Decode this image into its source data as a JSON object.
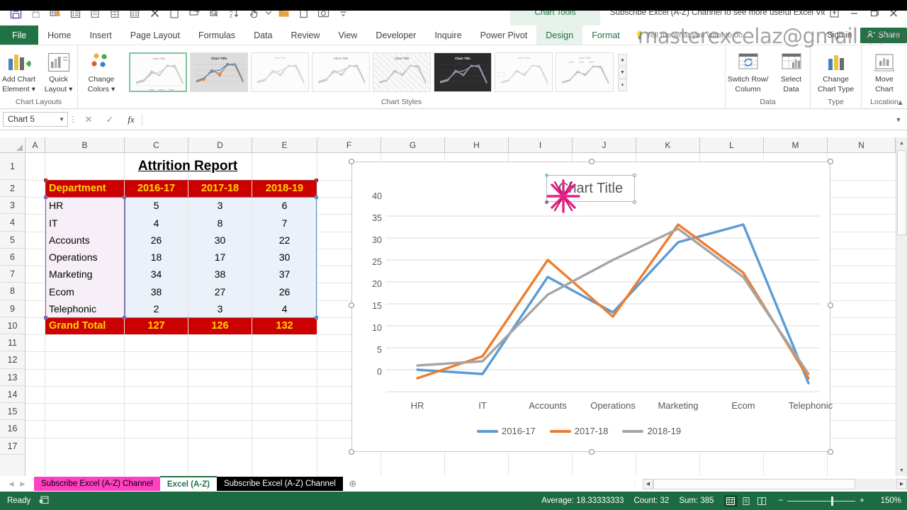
{
  "window": {
    "chart_tools_label": "Chart Tools",
    "document_title": "Subscribe Excel (A-Z) Channel to see more useful Excel Vide...",
    "watermark": "masterexcelaz@gmail.com",
    "restore_icon": "restore-up-icon",
    "minimize_icon": "minimize-icon",
    "maximize_icon": "maximize-icon",
    "close_icon": "close-icon"
  },
  "quick_access": [
    {
      "name": "save-icon",
      "glyph": "💾"
    },
    {
      "name": "lock-icon",
      "glyph": "🔒"
    },
    {
      "name": "protect-sheet-icon",
      "glyph": "▦"
    },
    {
      "name": "format-cells-icon",
      "glyph": "☷"
    },
    {
      "name": "table-icon",
      "glyph": "☰"
    },
    {
      "name": "grid-icon",
      "glyph": "▤"
    },
    {
      "name": "sheet-icon",
      "glyph": "▥"
    },
    {
      "name": "delete-icon",
      "glyph": "✕"
    },
    {
      "name": "paste-icon",
      "glyph": "📋"
    },
    {
      "name": "print-preview-icon",
      "glyph": "🖨"
    },
    {
      "name": "zoom-icon",
      "glyph": "🔍"
    },
    {
      "name": "sort-az-icon",
      "glyph": "↓"
    },
    {
      "name": "select-icon",
      "glyph": "☝"
    },
    {
      "name": "open-folder-icon",
      "glyph": "📁"
    },
    {
      "name": "new-file-icon",
      "glyph": "📄"
    },
    {
      "name": "camera-icon",
      "glyph": "📷"
    },
    {
      "name": "customize-qat-icon",
      "glyph": "≡"
    }
  ],
  "ribbon": {
    "tabs": [
      {
        "label": "File",
        "kind": "file"
      },
      {
        "label": "Home",
        "kind": "normal"
      },
      {
        "label": "Insert",
        "kind": "normal"
      },
      {
        "label": "Page Layout",
        "kind": "normal"
      },
      {
        "label": "Formulas",
        "kind": "normal"
      },
      {
        "label": "Data",
        "kind": "normal"
      },
      {
        "label": "Review",
        "kind": "normal"
      },
      {
        "label": "View",
        "kind": "normal"
      },
      {
        "label": "Developer",
        "kind": "normal"
      },
      {
        "label": "Inquire",
        "kind": "normal"
      },
      {
        "label": "Power Pivot",
        "kind": "normal"
      },
      {
        "label": "Design",
        "kind": "design"
      },
      {
        "label": "Format",
        "kind": "format"
      }
    ],
    "tell_me": "Tell me what you want to do",
    "sign_in": "Sign in",
    "share_label": "Share",
    "groups": {
      "chart_layouts": {
        "label": "Chart Layouts",
        "add_chart_element": "Add Chart\nElement",
        "add_chart_element_line1": "Add Chart",
        "add_chart_element_line2": "Element",
        "quick_layout_line1": "Quick",
        "quick_layout_line2": "Layout"
      },
      "chart_styles": {
        "label": "Chart Styles",
        "change_colors_line1": "Change",
        "change_colors_line2": "Colors",
        "selected_index": 0,
        "thumb_count": 8
      },
      "data": {
        "label": "Data",
        "switch_row_column_line1": "Switch Row/",
        "switch_row_column_line2": "Column",
        "select_data_line1": "Select",
        "select_data_line2": "Data"
      },
      "type": {
        "label": "Type",
        "change_chart_type_line1": "Change",
        "change_chart_type_line2": "Chart Type"
      },
      "location": {
        "label": "Location",
        "move_chart_line1": "Move",
        "move_chart_line2": "Chart"
      }
    }
  },
  "formula_bar": {
    "name_box_value": "Chart 5",
    "cancel_icon": "cancel-icon",
    "enter_icon": "enter-icon",
    "function_icon": "insert-function-icon",
    "formula_value": "",
    "formula_placeholder": ""
  },
  "grid": {
    "columns": [
      "A",
      "B",
      "C",
      "D",
      "E",
      "F",
      "G",
      "H",
      "I",
      "J",
      "K",
      "L",
      "M",
      "N"
    ],
    "rows": [
      1,
      2,
      3,
      4,
      5,
      6,
      7,
      8,
      9,
      10,
      11,
      12,
      13,
      14,
      15,
      16,
      17
    ],
    "report_title": "Attrition Report",
    "table_headers": [
      "Department",
      "2016-17",
      "2017-18",
      "2018-19"
    ],
    "table_rows": [
      {
        "department": "HR",
        "v1": "5",
        "v2": "3",
        "v3": "6"
      },
      {
        "department": "IT",
        "v1": "4",
        "v2": "8",
        "v3": "7"
      },
      {
        "department": "Accounts",
        "v1": "26",
        "v2": "30",
        "v3": "22"
      },
      {
        "department": "Operations",
        "v1": "18",
        "v2": "17",
        "v3": "30"
      },
      {
        "department": "Marketing",
        "v1": "34",
        "v2": "38",
        "v3": "37"
      },
      {
        "department": "Ecom",
        "v1": "38",
        "v2": "27",
        "v3": "26"
      },
      {
        "department": "Telephonic",
        "v1": "2",
        "v2": "3",
        "v3": "4"
      }
    ],
    "total_row": {
      "label": "Grand Total",
      "v1": "127",
      "v2": "126",
      "v3": "132"
    },
    "header_bg": "#CC0000",
    "header_fg": "#FFD700"
  },
  "chart": {
    "title": "Chart Title",
    "selected": true,
    "cursor_icon": "starburst-cursor-icon"
  },
  "chart_data": {
    "type": "line",
    "title": "Chart Title",
    "categories": [
      "HR",
      "IT",
      "Accounts",
      "Operations",
      "Marketing",
      "Ecom",
      "Telephonic"
    ],
    "series": [
      {
        "name": "2016-17",
        "color": "#5B9BD5",
        "values": [
          5,
          4,
          26,
          18,
          34,
          38,
          2
        ]
      },
      {
        "name": "2017-18",
        "color": "#ED7D31",
        "values": [
          3,
          8,
          30,
          17,
          38,
          27,
          3
        ]
      },
      {
        "name": "2018-19",
        "color": "#A5A5A5",
        "values": [
          6,
          7,
          22,
          30,
          37,
          26,
          4
        ]
      }
    ],
    "ylabel": "",
    "xlabel": "",
    "ylim": [
      0,
      40
    ],
    "yticks": [
      0,
      5,
      10,
      15,
      20,
      25,
      30,
      35,
      40
    ],
    "grid": true,
    "legend": "bottom"
  },
  "sheet_tabs": [
    {
      "label": "Subscribe Excel (A-Z) Channel",
      "state": "pink"
    },
    {
      "label": "Excel (A-Z)",
      "state": "active"
    },
    {
      "label": "Subscribe Excel (A-Z) Channel",
      "state": "black"
    }
  ],
  "add_sheet_icon": "add-sheet-icon",
  "status_bar": {
    "mode": "Ready",
    "macro_icon": "record-macro-icon",
    "average": "Average: 18.33333333",
    "count": "Count: 32",
    "sum": "Sum: 385",
    "views": [
      {
        "name": "normal-view-icon",
        "glyph": "▦",
        "active": true
      },
      {
        "name": "page-layout-view-icon",
        "glyph": "▤",
        "active": false
      },
      {
        "name": "page-break-view-icon",
        "glyph": "▥",
        "active": false
      }
    ],
    "zoom_out_icon": "zoom-out-icon",
    "zoom_in_icon": "zoom-in-icon",
    "zoom_level": "150%"
  }
}
